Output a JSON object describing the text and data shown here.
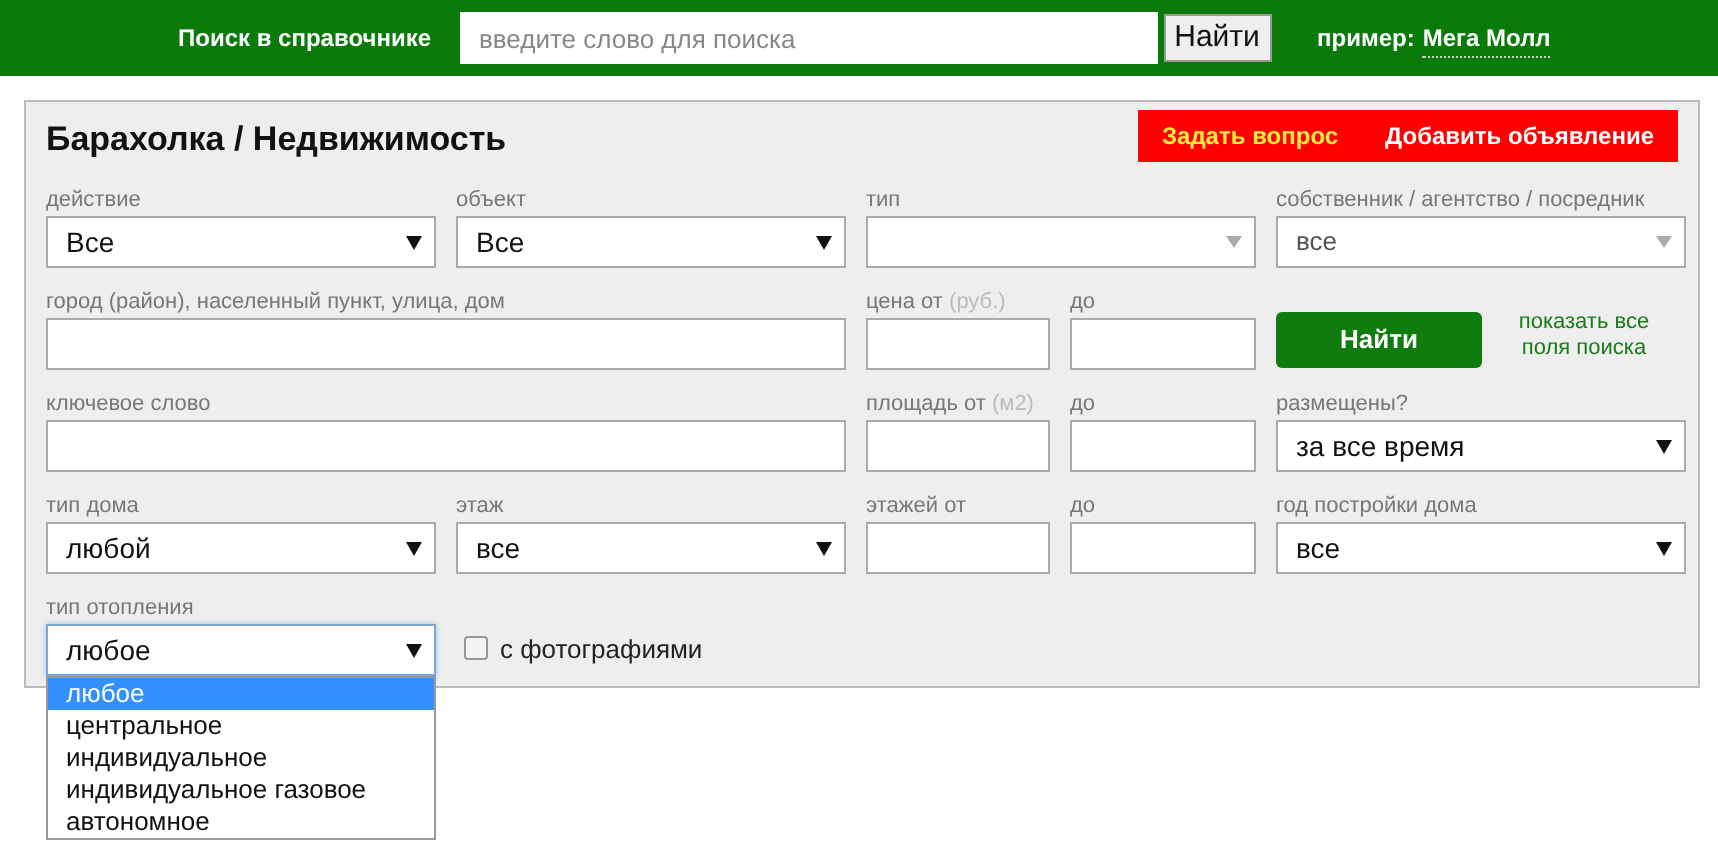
{
  "top_bar": {
    "label": "Поиск в справочнике",
    "search": {
      "placeholder": "введите слово для поиска"
    },
    "button": "Найти",
    "example_label": "пример:",
    "example_link": "Мега Молл"
  },
  "panel": {
    "title": "Барахолка / Недвижимость",
    "ask_button": "Задать вопрос",
    "add_button": "Добавить объявление"
  },
  "rows": [
    {
      "fields": [
        {
          "kind": "select",
          "label": "действие",
          "value": "Все",
          "disabled": false
        },
        {
          "kind": "select",
          "label": "объект",
          "value": "Все",
          "disabled": false
        },
        {
          "kind": "select_wide",
          "label": "тип",
          "disabled": true
        },
        {
          "kind": "select",
          "label": "собственник / агентство / посредник",
          "value": "все",
          "disabled": true
        }
      ]
    },
    {
      "fields": [
        {
          "kind": "text_wide",
          "label": "город (район), населенный пункт, улица, дом"
        },
        {
          "kind": "text",
          "label": "цена от",
          "unit": "(руб.)"
        },
        {
          "kind": "text",
          "label": "до"
        },
        {
          "kind": "search_button",
          "label": "Найти",
          "link": "показать все поля поиска"
        }
      ]
    },
    {
      "fields": [
        {
          "kind": "text_wide",
          "label": "ключевое слово"
        },
        {
          "kind": "text",
          "label": "площадь от",
          "unit": "(м2)"
        },
        {
          "kind": "text",
          "label": "до"
        },
        {
          "kind": "select",
          "label": "размещены?",
          "value": "за все время",
          "disabled": false
        }
      ]
    },
    {
      "fields": [
        {
          "kind": "select",
          "label": "тип дома",
          "value": "любой",
          "disabled": false
        },
        {
          "kind": "select",
          "label": "этаж",
          "value": "все",
          "disabled": false
        },
        {
          "kind": "text",
          "label": "этажей от"
        },
        {
          "kind": "text",
          "label": "до"
        },
        {
          "kind": "select",
          "label": "год постройки дома",
          "value": "все",
          "disabled": false
        }
      ]
    },
    {
      "fields": [
        {
          "kind": "select",
          "label": "тип отопления",
          "value": "любое",
          "disabled": false,
          "expanded": true,
          "options": [
            {
              "label": "любое",
              "selected": true
            },
            {
              "label": "центральное",
              "selected": false
            },
            {
              "label": "индивидуальное",
              "selected": false
            },
            {
              "label": "индивидуальное газовое",
              "selected": false
            },
            {
              "label": "автономное",
              "selected": false
            }
          ]
        },
        {
          "kind": "checkbox",
          "label": "с фотографиями",
          "checked": false
        }
      ]
    }
  ]
}
